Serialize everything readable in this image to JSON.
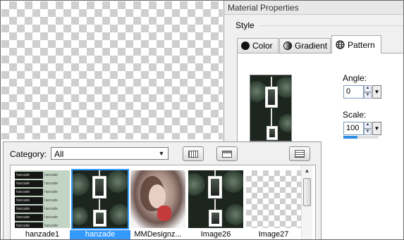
{
  "dialog": {
    "title": "Material Properties",
    "style_label": "Style",
    "tabs": [
      {
        "label": "Color",
        "icon": "black-circle-icon"
      },
      {
        "label": "Gradient",
        "icon": "gradient-circle-icon"
      },
      {
        "label": "Pattern",
        "icon": "globe-icon",
        "active": true
      }
    ],
    "angle_label": "Angle:",
    "angle_value": "0",
    "scale_label": "Scale:",
    "scale_value": "100",
    "scale_level": 0.4
  },
  "browser": {
    "category_label": "Category:",
    "category_value": "All",
    "thumbnails": [
      {
        "label": "hanzade1",
        "selected": false
      },
      {
        "label": "hanzade",
        "selected": true
      },
      {
        "label": "MMDesignz...",
        "selected": false
      },
      {
        "label": "Image26",
        "selected": false
      },
      {
        "label": "Image27",
        "selected": false
      }
    ]
  },
  "colors": {
    "selection": "#3399ff",
    "dialog_bg": "#f0f0f0",
    "pattern_dark": "#1c261f"
  }
}
